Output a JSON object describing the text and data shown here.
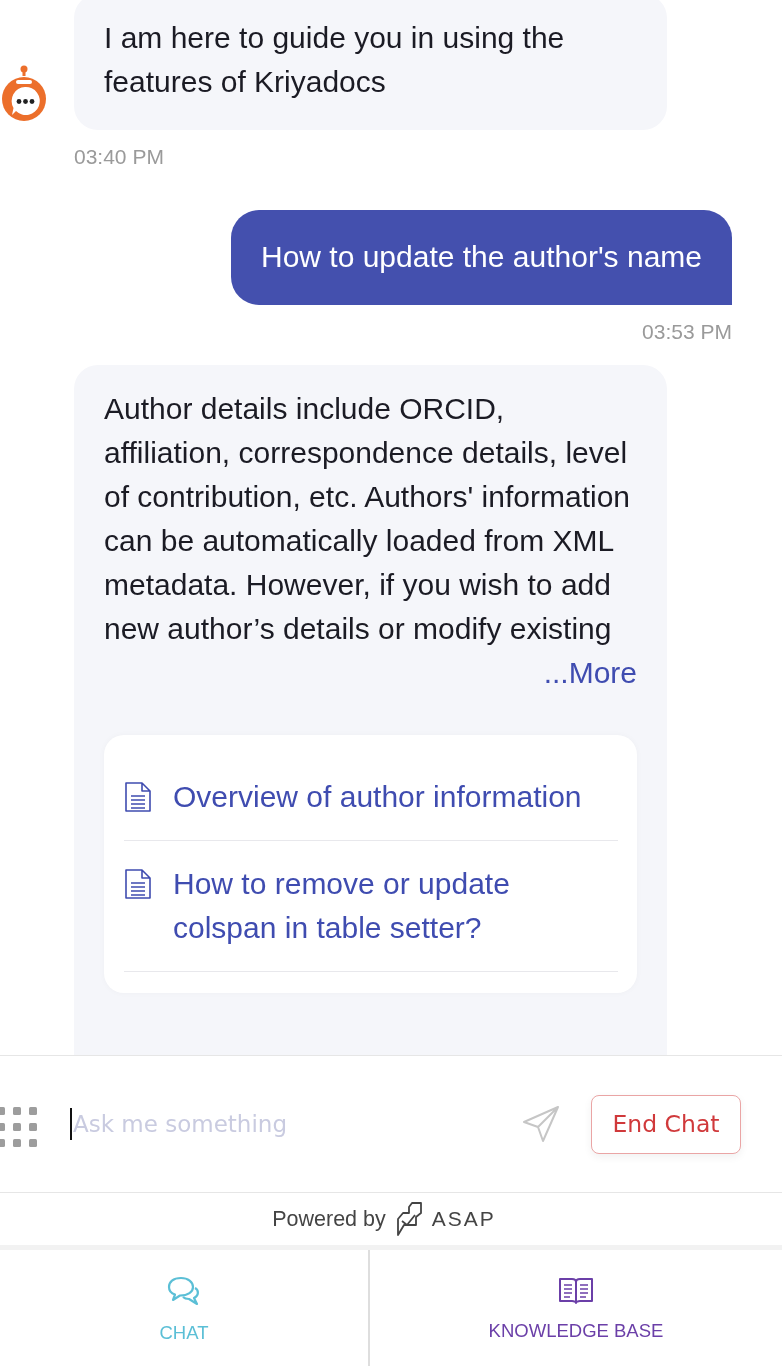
{
  "messages": [
    {
      "kind": "bot",
      "avatar": true,
      "text": "I am here to guide you in using the features of Kriyadocs",
      "time": "03:40 PM"
    },
    {
      "kind": "user",
      "text": "How to update the author's name",
      "time": "03:53 PM"
    },
    {
      "kind": "bot",
      "avatar": false,
      "text": "Author details include ORCID, affiliation, correspondence details, level of contribution, etc. Authors' information can be automatically loaded from XML metadata. However, if you wish to add new author’s details or modify existing",
      "more": "...More",
      "links": [
        "Overview of author information",
        "How to remove or update colspan in table setter?"
      ]
    }
  ],
  "composer": {
    "placeholder": "Ask me something",
    "end_button": "End Chat"
  },
  "powered_by": {
    "label": "Powered by",
    "brand": "ASAP"
  },
  "tabs": [
    {
      "kind": "chat",
      "label": "CHAT",
      "color": "#5bbfd6"
    },
    {
      "kind": "knowledge",
      "label": "KNOWLEDGE BASE",
      "color": "#6b3fa8"
    }
  ]
}
